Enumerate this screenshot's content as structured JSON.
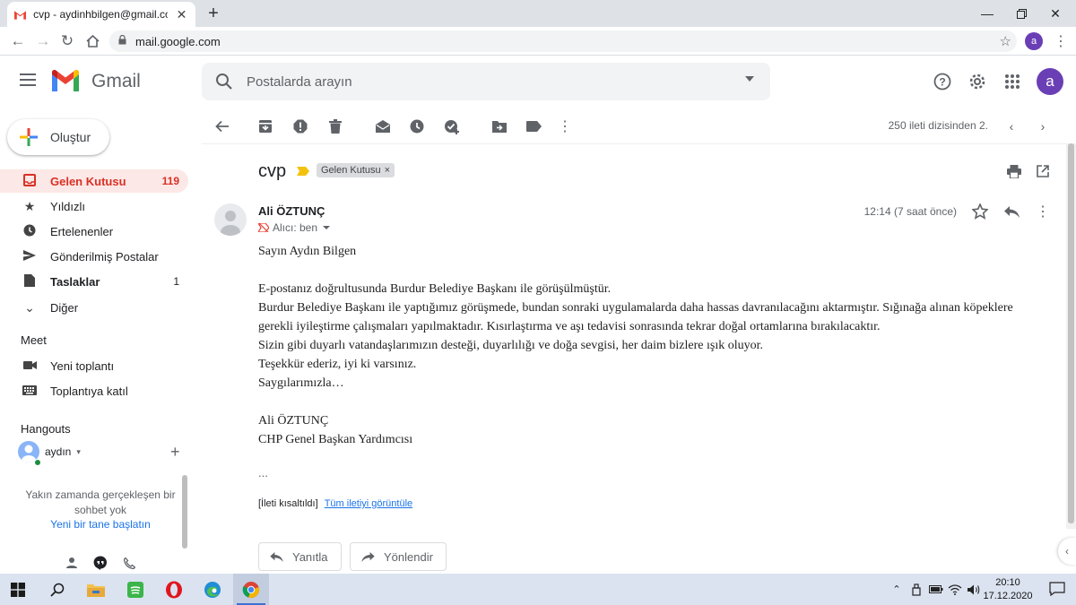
{
  "browser": {
    "tab_title": "cvp - aydinhbilgen@gmail.com -",
    "url": "mail.google.com",
    "profile_initial": "a"
  },
  "gmail": {
    "brand": "Gmail",
    "search_placeholder": "Postalarda arayın",
    "avatar_initial": "a"
  },
  "sidebar": {
    "compose_label": "Oluştur",
    "items": [
      {
        "label": "Gelen Kutusu",
        "count": "119",
        "icon": "inbox-icon"
      },
      {
        "label": "Yıldızlı",
        "count": "",
        "icon": "star-icon"
      },
      {
        "label": "Ertelenenler",
        "count": "",
        "icon": "clock-icon"
      },
      {
        "label": "Gönderilmiş Postalar",
        "count": "",
        "icon": "send-icon"
      },
      {
        "label": "Taslaklar",
        "count": "1",
        "icon": "draft-icon"
      },
      {
        "label": "Diğer",
        "count": "",
        "icon": "chevron-down-icon"
      }
    ],
    "meet": {
      "title": "Meet",
      "items": [
        {
          "label": "Yeni toplantı",
          "icon": "video-icon"
        },
        {
          "label": "Toplantıya katıl",
          "icon": "keyboard-icon"
        }
      ]
    },
    "hangouts": {
      "title": "Hangouts",
      "user": "aydın",
      "empty_text": "Yakın zamanda gerçekleşen bir sohbet yok",
      "start_link": "Yeni bir tane başlatın"
    }
  },
  "message": {
    "page_info": "250 ileti dizisinden 2.",
    "subject": "cvp",
    "label_chip": "Gelen Kutusu",
    "label_chip_close": "×",
    "sender": "Ali ÖZTUNÇ",
    "recipient": "Alıcı: ben",
    "time": "12:14 (7 saat önce)",
    "body_lines": [
      "Sayın Aydın Bilgen",
      "",
      "E-postanız doğrultusunda Burdur Belediye Başkanı ile görüşülmüştür.",
      "Burdur Belediye Başkanı ile yaptığımız görüşmede, bundan sonraki uygulamalarda daha hassas davranılacağını aktarmıştır. Sığınağa alınan köpeklere gerekli iyileştirme çalışmaları yapılmaktadır. Kısırlaştırma ve aşı tedavisi sonrasında tekrar doğal ortamlarına bırakılacaktır.",
      "Sizin gibi duyarlı vatandaşlarımızın desteği, duyarlılığı ve doğa sevgisi, her daim bizlere ışık oluyor.",
      "Teşekkür ederiz, iyi ki varsınız.",
      "Saygılarımızla…",
      "",
      "Ali ÖZTUNÇ",
      "CHP Genel Başkan Yardımcısı"
    ],
    "ellipsis": "...",
    "clipped_note": "[İleti kısaltıldı]",
    "view_full_link": "Tüm iletiyi görüntüle",
    "reply_label": "Yanıtla",
    "forward_label": "Yönlendir"
  },
  "taskbar": {
    "time": "20:10",
    "date": "17.12.2020"
  },
  "colors": {
    "inbox_accent": "#d93025",
    "link": "#1a73e8",
    "avatar": "#6a3fb5"
  }
}
